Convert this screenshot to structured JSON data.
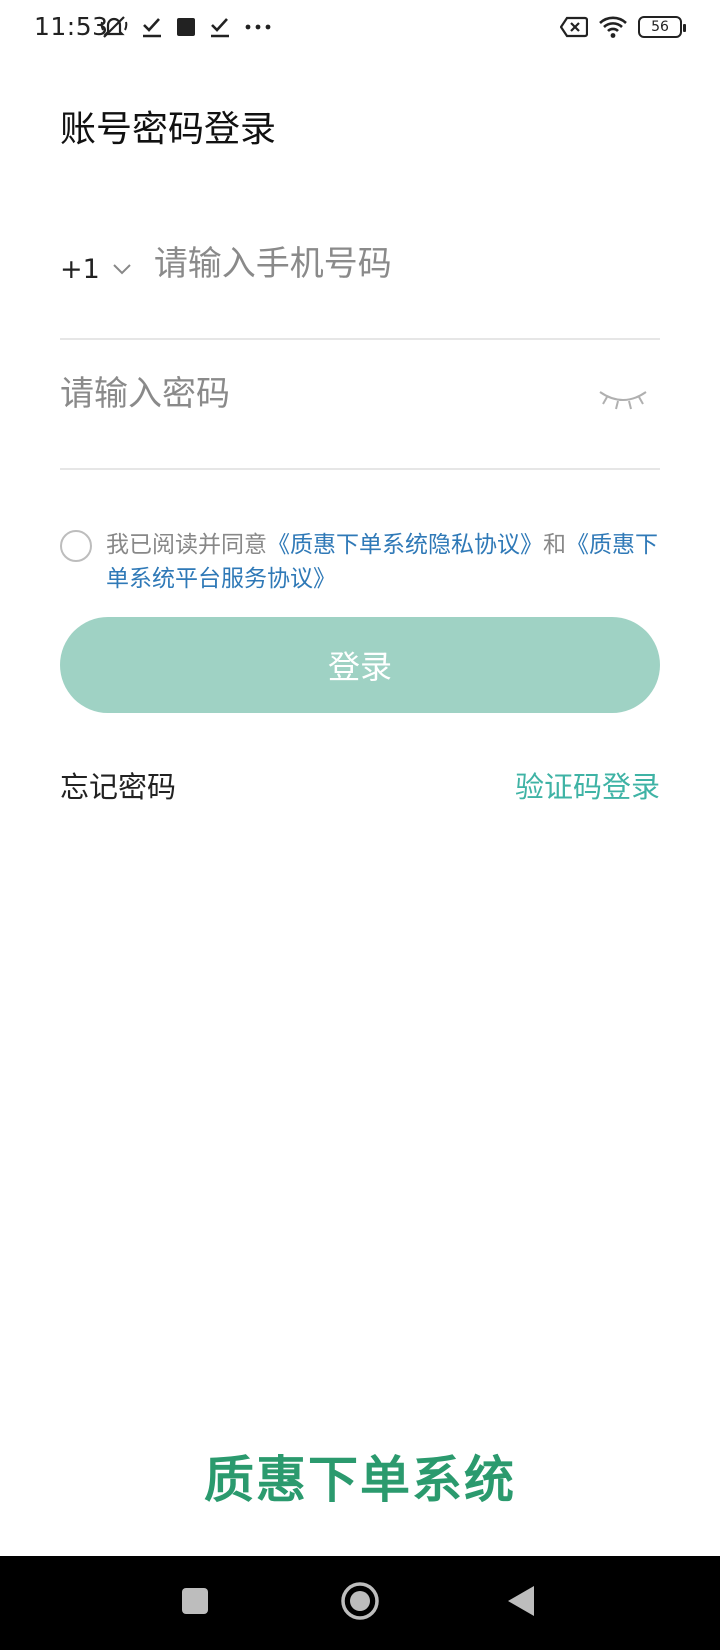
{
  "status_bar": {
    "time": "11:53",
    "battery_level": "56",
    "left_icons": [
      "mute-icon",
      "check-icon",
      "square-icon",
      "check-icon",
      "more-dots-icon"
    ],
    "right_icons": [
      "no-sim-icon",
      "wifi-icon",
      "battery-icon"
    ]
  },
  "page": {
    "title": "账号密码登录"
  },
  "phone": {
    "country_code": "+1",
    "placeholder": "请输入手机号码",
    "value": ""
  },
  "password": {
    "placeholder": "请输入密码",
    "value": ""
  },
  "agreement": {
    "checked": false,
    "prefix": "我已阅读并同意",
    "privacy_link": "《质惠下单系统隐私协议》",
    "joiner": "和",
    "service_link": "《质惠下单系统平台服务协议》"
  },
  "login_button": {
    "label": "登录",
    "color": "#9fd2c4"
  },
  "links": {
    "forgot_password": "忘记密码",
    "code_login": "验证码登录",
    "code_login_color": "#3fb3a5"
  },
  "brand": {
    "name": "质惠下单系统",
    "color": "#2b9a6e"
  },
  "nav_bar": {
    "buttons": [
      "recents-square-icon",
      "home-circle-icon",
      "back-triangle-icon"
    ]
  }
}
